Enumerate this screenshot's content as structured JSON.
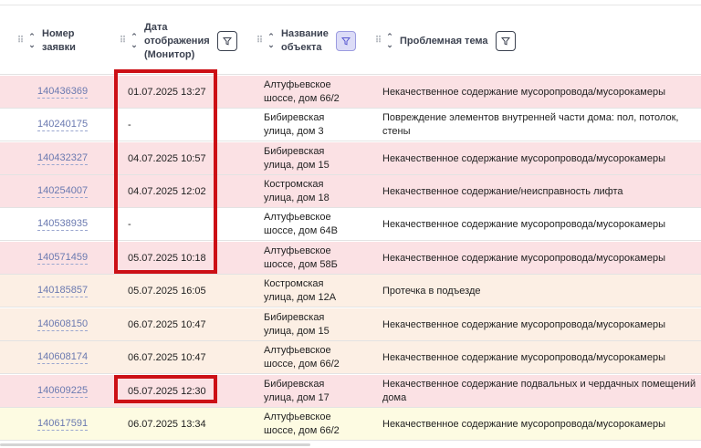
{
  "columns": {
    "number": "Номер заявки",
    "number_l1": "Номер",
    "number_l2": "заявки",
    "date_l1": "Дата",
    "date_l2": "отображения",
    "date_l3": "(Монитор)",
    "object_l1": "Название",
    "object_l2": "объекта",
    "topic": "Проблемная тема"
  },
  "colors": {
    "pink": "#fbe1e4",
    "peach": "#fcefe4",
    "yellow": "#fdfbe2",
    "white": "#ffffff",
    "highlight": "#cc1016"
  },
  "rows": [
    {
      "id": "140436369",
      "date": "01.07.2025 13:27",
      "obj1": "Алтуфьевское",
      "obj2": "шоссе, дом 66/2",
      "topic1": "Некачественное содержание мусоропровода/мусорокамеры",
      "topic2": "",
      "bg": "pink"
    },
    {
      "id": "140240175",
      "date": "-",
      "obj1": "Бибиревская",
      "obj2": "улица, дом 3",
      "topic1": "Повреждение элементов внутренней части дома: пол, потолок,",
      "topic2": "стены",
      "bg": "white"
    },
    {
      "id": "140432327",
      "date": "04.07.2025 10:57",
      "obj1": "Бибиревская",
      "obj2": "улица, дом 15",
      "topic1": "Некачественное содержание мусоропровода/мусорокамеры",
      "topic2": "",
      "bg": "pink"
    },
    {
      "id": "140254007",
      "date": "04.07.2025 12:02",
      "obj1": "Костромская",
      "obj2": "улица, дом 18",
      "topic1": "Некачественное содержание/неисправность лифта",
      "topic2": "",
      "bg": "pink"
    },
    {
      "id": "140538935",
      "date": "-",
      "obj1": "Алтуфьевское",
      "obj2": "шоссе, дом 64В",
      "topic1": "Некачественное содержание мусоропровода/мусорокамеры",
      "topic2": "",
      "bg": "white"
    },
    {
      "id": "140571459",
      "date": "05.07.2025 10:18",
      "obj1": "Алтуфьевское",
      "obj2": "шоссе, дом 58Б",
      "topic1": "Некачественное содержание мусоропровода/мусорокамеры",
      "topic2": "",
      "bg": "pink"
    },
    {
      "id": "140185857",
      "date": "05.07.2025 16:05",
      "obj1": "Костромская",
      "obj2": "улица, дом 12А",
      "topic1": "Протечка в подъезде",
      "topic2": "",
      "bg": "peach"
    },
    {
      "id": "140608150",
      "date": "06.07.2025 10:47",
      "obj1": "Бибиревская",
      "obj2": "улица, дом 15",
      "topic1": "Некачественное содержание мусоропровода/мусорокамеры",
      "topic2": "",
      "bg": "peach"
    },
    {
      "id": "140608174",
      "date": "06.07.2025 10:47",
      "obj1": "Алтуфьевское",
      "obj2": "шоссе, дом 66/2",
      "topic1": "Некачественное содержание мусоропровода/мусорокамеры",
      "topic2": "",
      "bg": "peach"
    },
    {
      "id": "140609225",
      "date": "05.07.2025 12:30",
      "obj1": "Бибиревская",
      "obj2": "улица, дом 17",
      "topic1": "Некачественное содержание подвальных и чердачных помещений",
      "topic2": "дома",
      "bg": "pink"
    },
    {
      "id": "140617591",
      "date": "06.07.2025 13:34",
      "obj1": "Алтуфьевское",
      "obj2": "шоссе, дом 66/2",
      "topic1": "Некачественное содержание мусоропровода/мусорокамеры",
      "topic2": "",
      "bg": "yellow"
    }
  ]
}
